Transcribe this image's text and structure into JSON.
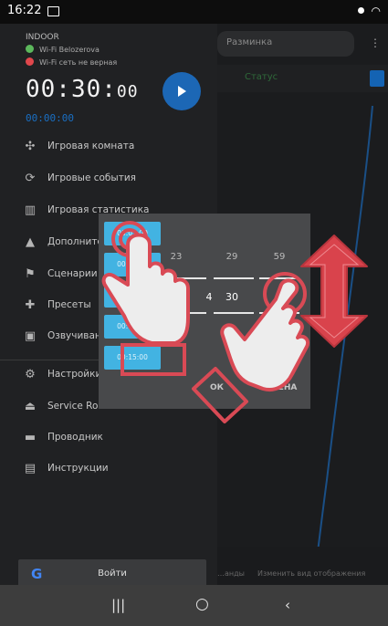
{
  "status_bar": {
    "time": "16:22"
  },
  "background": {
    "header_title": "Разминка",
    "tab_label": "Статус",
    "bottom_left": "…анды",
    "bottom_right": "Изменить вид отображения"
  },
  "drawer": {
    "indoor": "INDOOR",
    "wifi_ok": "Wi-Fi Belozerova",
    "wifi_bad": "Wi-Fi сеть не верная",
    "timer_main": "00:30:",
    "timer_small": "00",
    "timer_sub": "00:00:00",
    "menu_top": [
      {
        "icon": "gamepad-icon",
        "glyph": "✣",
        "label": "Игровая комната"
      },
      {
        "icon": "timer-icon",
        "glyph": "⟳",
        "label": "Игровые события"
      },
      {
        "icon": "bar-chart-icon",
        "glyph": "▥",
        "label": "Игровая статистика"
      },
      {
        "icon": "addons-icon",
        "glyph": "▲",
        "label": "Дополнительно"
      },
      {
        "icon": "flag-icon",
        "glyph": "⚑",
        "label": "Сценарии"
      },
      {
        "icon": "puzzle-icon",
        "glyph": "✚",
        "label": "Пресеты"
      },
      {
        "icon": "audio-library-icon",
        "glyph": "▣",
        "label": "Озвучивание"
      }
    ],
    "menu_bottom": [
      {
        "icon": "gear-icon",
        "glyph": "⚙",
        "label": "Настройки"
      },
      {
        "icon": "eject-icon",
        "glyph": "⏏",
        "label": "Service Room"
      },
      {
        "icon": "folder-icon",
        "glyph": "▬",
        "label": "Проводник"
      },
      {
        "icon": "book-icon",
        "glyph": "▤",
        "label": "Инструкции"
      }
    ],
    "login_label": "Войти",
    "login_glyph": "G"
  },
  "time_picker": {
    "top_row": [
      "23",
      "29",
      "59"
    ],
    "current": {
      "hours": "0",
      "hours_prev": "4",
      "minutes": "30",
      "seconds": "0"
    },
    "ok_label": "ОК",
    "cancel_label": "ОТМЕНА"
  },
  "preset_chips": [
    "00:01:00",
    "00:05:00",
    "00:07:00",
    "00:10:00",
    "00:15:00"
  ],
  "colors": {
    "accent_blue": "#1c67b5",
    "chip_blue": "#42b3e2",
    "hand_red": "#d94a55",
    "arrow_red": "#d9434c",
    "wifi_ok_green": "#5cb85c",
    "wifi_bad_red": "#e0474c"
  }
}
